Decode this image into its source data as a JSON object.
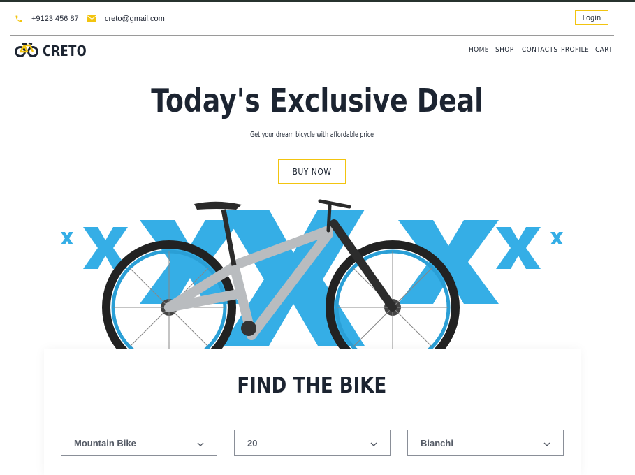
{
  "topbar": {
    "phone": "+9123 456 87",
    "email": "creto@gmail.com",
    "login_label": "Login"
  },
  "brand": {
    "name": "CRETO"
  },
  "nav": {
    "items": [
      {
        "label": "HOME"
      },
      {
        "label": "SHOP"
      },
      {
        "label": "CONTACTS"
      },
      {
        "label": "PROFILE"
      },
      {
        "label": "CART"
      }
    ]
  },
  "hero": {
    "title": "Today's Exclusive Deal",
    "subtitle": "Get your dream bicycle with affordable price",
    "cta_label": "BUY NOW"
  },
  "finder": {
    "title": "FIND THE BIKE",
    "filters": [
      {
        "value": "Mountain Bike"
      },
      {
        "value": "20"
      },
      {
        "value": "Bianchi"
      }
    ]
  },
  "colors": {
    "accent_yellow": "#f2c40f",
    "accent_blue": "#35aee6",
    "text_dark": "#1c2431"
  },
  "icons": {
    "phone": "phone-icon",
    "email": "envelope-icon",
    "logo": "bicycle-logo-icon",
    "dropdown": "chevron-down-icon"
  }
}
